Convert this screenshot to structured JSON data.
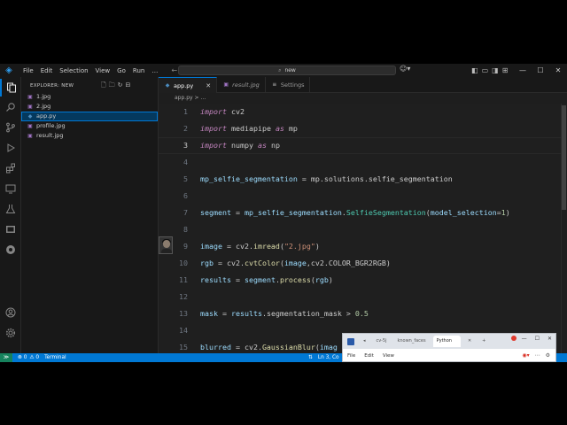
{
  "titlebar": {
    "menu": [
      "File",
      "Edit",
      "Selection",
      "View",
      "Go",
      "Run",
      "…"
    ],
    "command_center": "new",
    "window_controls": [
      "—",
      "☐",
      "✕"
    ]
  },
  "activity_icons": [
    "explorer-icon",
    "search-icon",
    "source-control-icon",
    "run-debug-icon",
    "extensions-icon",
    "remote-explorer-icon",
    "testing-icon",
    "docker-icon",
    "github-icon",
    "accounts-icon",
    "settings-icon"
  ],
  "sidebar": {
    "title": "EXPLORER: NEW",
    "files": [
      {
        "name": "1.jpg",
        "type": "image",
        "selected": false
      },
      {
        "name": "2.jpg",
        "type": "image",
        "selected": false
      },
      {
        "name": "app.py",
        "type": "python",
        "selected": true
      },
      {
        "name": "profile.jpg",
        "type": "image",
        "selected": false
      },
      {
        "name": "result.jpg",
        "type": "image",
        "selected": false
      }
    ]
  },
  "tabs": [
    {
      "label": "app.py",
      "active": true,
      "close": "✕"
    },
    {
      "label": "result.jpg",
      "active": false,
      "italic": true
    },
    {
      "label": "Settings",
      "active": false
    }
  ],
  "breadcrumb": "app.py > …",
  "editor": {
    "lines": [
      {
        "n": "1",
        "html": "<span class=\"kw\">import</span> cv2"
      },
      {
        "n": "2",
        "html": "<span class=\"kw\">import</span> mediapipe <span class=\"kw\">as</span> mp"
      },
      {
        "n": "3",
        "html": "<span class=\"kw\">import</span> numpy <span class=\"kw\">as</span> np"
      },
      {
        "n": "4",
        "html": ""
      },
      {
        "n": "5",
        "html": "<span class=\"var\">mp_selfie_segmentation</span> = mp.solutions.selfie_segmentation"
      },
      {
        "n": "6",
        "html": ""
      },
      {
        "n": "7",
        "html": "<span class=\"var\">segment</span> = <span class=\"var\">mp_selfie_segmentation</span>.<span class=\"cls\">SelfieSegmentation</span>(<span class=\"var\">model_selection</span>=<span class=\"num\">1</span>)"
      },
      {
        "n": "8",
        "html": ""
      },
      {
        "n": "9",
        "html": "<span class=\"var\">image</span> = cv2.<span class=\"fn\">imread</span>(<span class=\"str\">\"2.jpg\"</span>)"
      },
      {
        "n": "10",
        "html": "<span class=\"var\">rgb</span> = cv2.<span class=\"fn\">cvtColor</span>(<span class=\"var\">image</span>,cv2.COLOR_BGR2RGB)"
      },
      {
        "n": "11",
        "html": "<span class=\"var\">results</span> = <span class=\"var\">segment</span>.<span class=\"fn\">process</span>(<span class=\"var\">rgb</span>)"
      },
      {
        "n": "12",
        "html": ""
      },
      {
        "n": "13",
        "html": "<span class=\"var\">mask</span> = <span class=\"var\">results</span>.segmentation_mask &gt; <span class=\"num\">0.5</span>"
      },
      {
        "n": "14",
        "html": ""
      },
      {
        "n": "15",
        "html": "<span class=\"var\">blurred</span> = cv2.<span class=\"fn\">GaussianBlur</span>(<span class=\"var\">imag</span>"
      }
    ],
    "current_line": "3"
  },
  "status": {
    "remote": "≫",
    "errors": "⊗ 0",
    "warnings": "⚠ 0",
    "terminal": "Terminal",
    "position": "Ln 3, Co"
  },
  "browser": {
    "tabs": [
      "cv-5j",
      "known_faces",
      "Python"
    ],
    "new_tab": "+",
    "menu": [
      "File",
      "Edit",
      "View"
    ]
  },
  "colors": {
    "accent": "#0078d4",
    "keyword": "#c586c0",
    "variable": "#9cdcfe",
    "function": "#dcdcaa",
    "class": "#4ec9b0",
    "string": "#ce9178",
    "number": "#b5cea8"
  }
}
